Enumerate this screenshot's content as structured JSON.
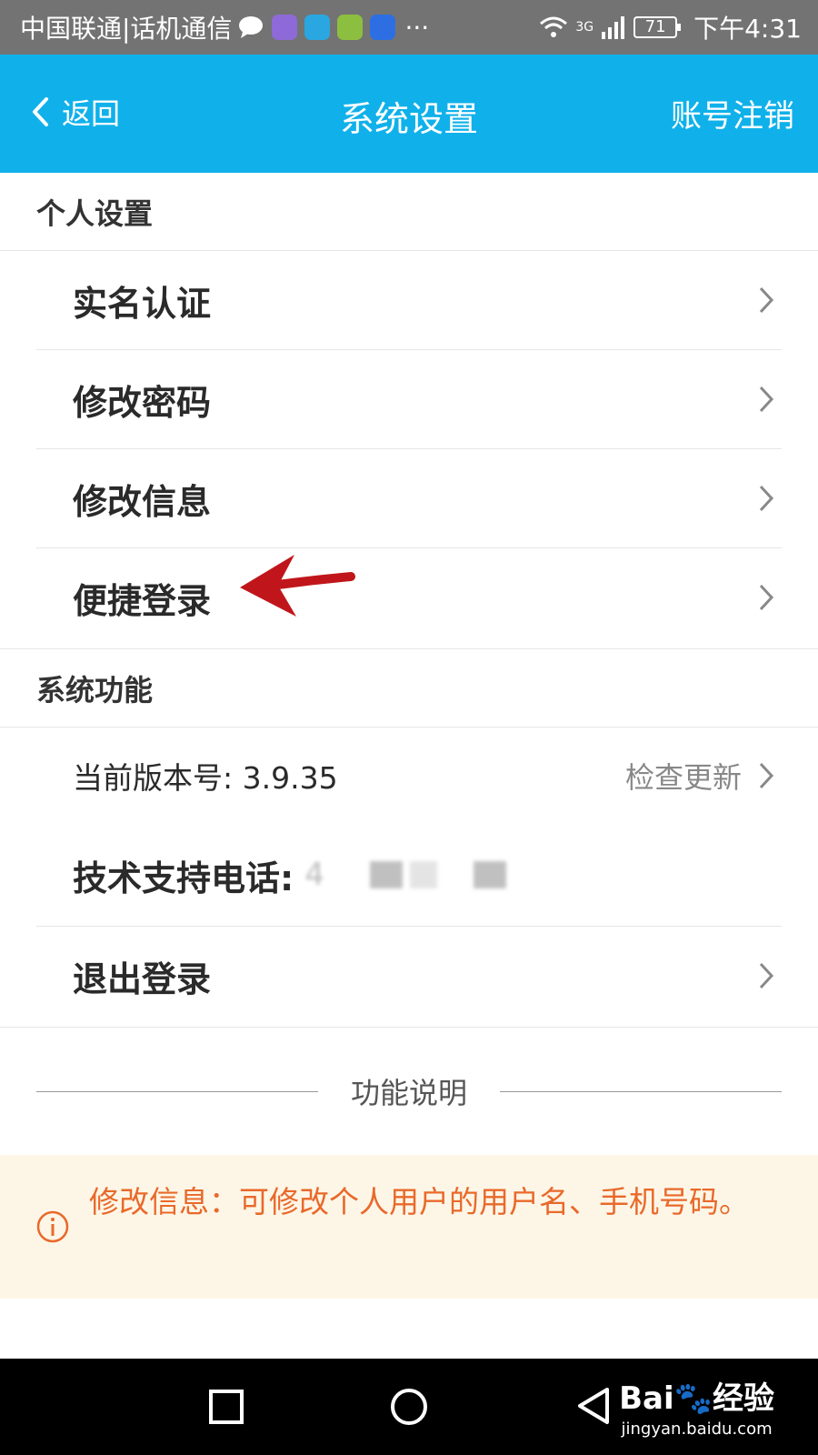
{
  "status_bar": {
    "carrier": "中国联通|话机通信",
    "more": "···",
    "network": "3G",
    "battery": "71",
    "time": "下午4:31"
  },
  "header": {
    "back_label": "返回",
    "title": "系统设置",
    "action_label": "账号注销"
  },
  "personal": {
    "title": "个人设置",
    "items": [
      {
        "label": "实名认证"
      },
      {
        "label": "修改密码"
      },
      {
        "label": "修改信息"
      },
      {
        "label": "便捷登录"
      }
    ]
  },
  "system": {
    "title": "系统功能",
    "version_label": "当前版本号: 3.9.35",
    "check_update": "检查更新",
    "support_label": "技术支持电话:",
    "support_value_digit": "4",
    "logout_label": "退出登录"
  },
  "function_desc": {
    "title": "功能说明",
    "text": "修改信息：可修改个人用户的用户名、手机号码。"
  },
  "watermark": {
    "brand": "Bai🐾经验",
    "url": "jingyan.baidu.com"
  },
  "colors": {
    "header_bg": "#10b1ea",
    "status_bg": "#737373",
    "info_bg": "#fdf6e7",
    "info_text": "#e9692a",
    "annotation_arrow": "#c0161b"
  }
}
